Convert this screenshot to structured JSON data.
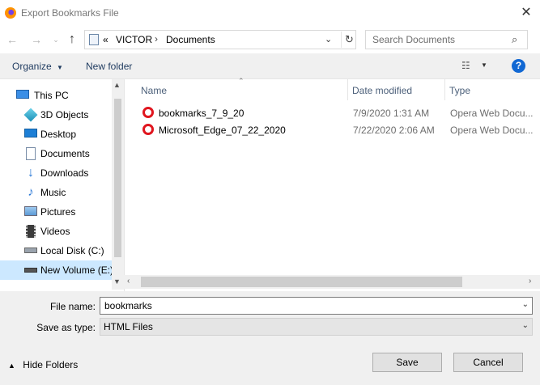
{
  "window": {
    "title": "Export Bookmarks File"
  },
  "address": {
    "overflow": "«",
    "crumbs": [
      "VICTOR",
      "Documents"
    ]
  },
  "search": {
    "placeholder": "Search Documents"
  },
  "toolbar": {
    "organize": "Organize",
    "new_folder": "New folder"
  },
  "nav": {
    "items": [
      {
        "label": "This PC",
        "icon": "computer-icon"
      },
      {
        "label": "3D Objects",
        "icon": "cube-icon"
      },
      {
        "label": "Desktop",
        "icon": "desktop-icon"
      },
      {
        "label": "Documents",
        "icon": "document-icon"
      },
      {
        "label": "Downloads",
        "icon": "download-icon"
      },
      {
        "label": "Music",
        "icon": "music-icon"
      },
      {
        "label": "Pictures",
        "icon": "picture-icon"
      },
      {
        "label": "Videos",
        "icon": "video-icon"
      },
      {
        "label": "Local Disk (C:)",
        "icon": "drive-icon"
      },
      {
        "label": "New Volume (E:)",
        "icon": "drive-icon"
      }
    ],
    "selected_index": 9
  },
  "columns": {
    "name": "Name",
    "date": "Date modified",
    "type": "Type"
  },
  "files": [
    {
      "name": "bookmarks_7_9_20",
      "date": "7/9/2020 1:31 AM",
      "type": "Opera Web Docu..."
    },
    {
      "name": "Microsoft_Edge_07_22_2020",
      "date": "7/22/2020 2:06 AM",
      "type": "Opera Web Docu..."
    }
  ],
  "form": {
    "filename_label": "File name:",
    "filename_value": "bookmarks",
    "savetype_label": "Save as type:",
    "savetype_value": "HTML Files"
  },
  "footer": {
    "hide_folders": "Hide Folders",
    "save": "Save",
    "cancel": "Cancel"
  },
  "colors": {
    "accent": "#1168d3",
    "selection": "#cce8ff",
    "opera_red": "#e0161f"
  }
}
